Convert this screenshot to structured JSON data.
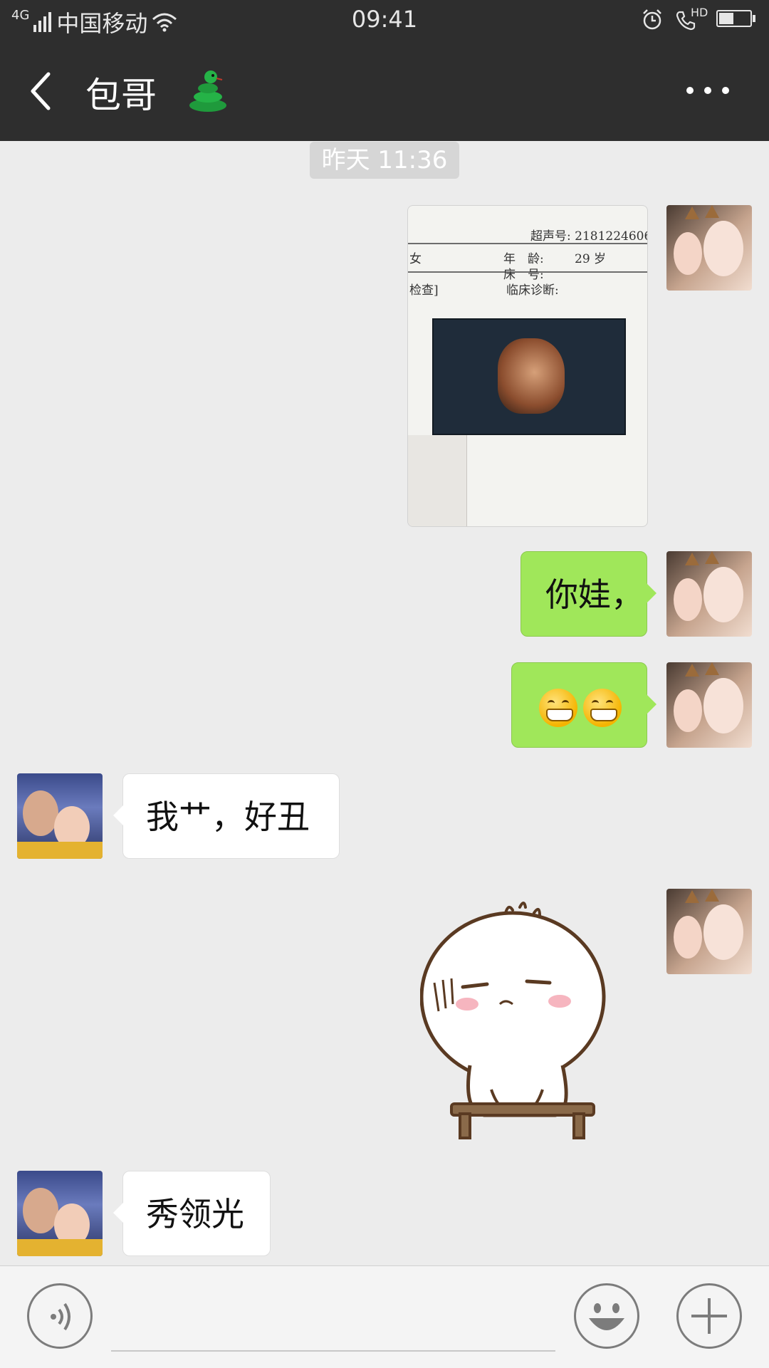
{
  "status_bar": {
    "network_type": "4G",
    "carrier": "中国移动",
    "time": "09:41",
    "hd_label": "HD",
    "icons": [
      "signal-icon",
      "wifi-icon",
      "alarm-icon",
      "phone-hd-icon",
      "battery-icon"
    ]
  },
  "nav": {
    "title": "包哥",
    "title_emoji": "snake-emoji",
    "back_icon": "back-chevron-icon",
    "more_icon": "more-dots-icon"
  },
  "timestamp": "昨天 11:36",
  "messages": [
    {
      "side": "right",
      "type": "image",
      "image_text": {
        "ultrasound_no": "超声号: 2181224606",
        "sex_fragment": "女",
        "age_label": "年　龄:",
        "age_value": "29 岁",
        "bed_label": "床　号:",
        "exam_fragment": "检查]",
        "diagnosis_label": "临床诊断:"
      }
    },
    {
      "side": "right",
      "type": "text",
      "text": "你娃，"
    },
    {
      "side": "right",
      "type": "emoji",
      "emojis": [
        "grinning-face-emoji",
        "grinning-face-emoji"
      ]
    },
    {
      "side": "left",
      "type": "text",
      "text": "我艹，好丑"
    },
    {
      "side": "right",
      "type": "sticker",
      "sticker": "bun-sitting-on-stool-sticker"
    },
    {
      "side": "left",
      "type": "text",
      "text": "秀领光"
    }
  ],
  "input_bar": {
    "voice_icon": "voice-icon",
    "emoji_icon": "emoji-smile-icon",
    "plus_icon": "plus-icon"
  },
  "colors": {
    "nav_background": "#2e2e2e",
    "chat_background": "#ececec",
    "my_bubble": "#a0e75a",
    "their_bubble": "#ffffff"
  }
}
